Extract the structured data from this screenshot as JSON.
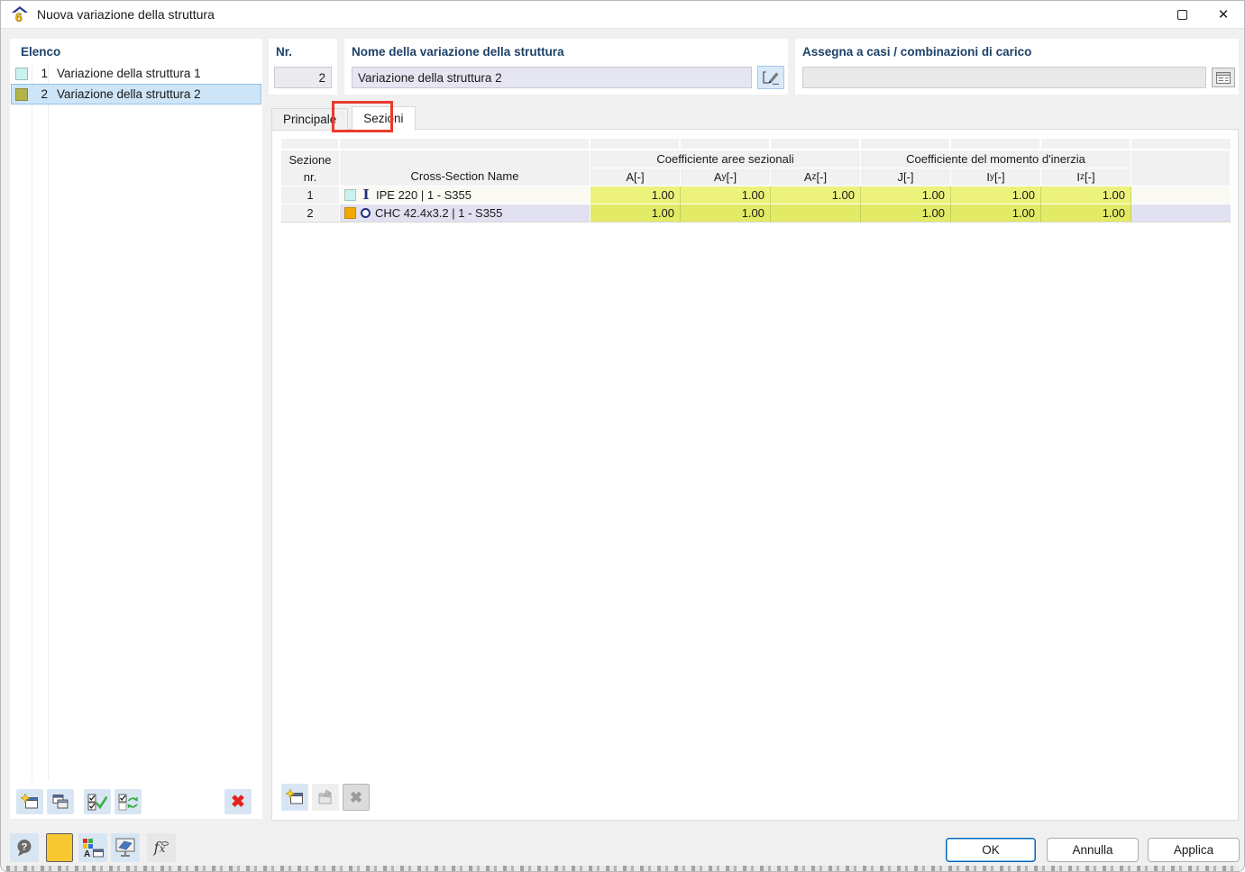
{
  "window": {
    "title": "Nuova variazione della struttura"
  },
  "icons": {
    "close": "✕",
    "delete": "✖",
    "help": "?",
    "app_number": "6",
    "i_section": "I",
    "fx_f": "f",
    "fx_x": "x",
    "display_letter": "A"
  },
  "colors": {
    "accent_navy": "#1D4268",
    "selection_bg": "#CDE5F7",
    "annotation_red": "#E93B2D",
    "ok_border": "#0067C0",
    "value_cell_row1": "#ECF27C",
    "value_cell_row2": "#E2EA66"
  },
  "list_panel": {
    "header": "Elenco",
    "items": [
      {
        "nr": "1",
        "label": "Variazione della struttura 1",
        "color": "#C9F2EF",
        "selected": false
      },
      {
        "nr": "2",
        "label": "Variazione della struttura 2",
        "color": "#B3B347",
        "selected": true
      }
    ]
  },
  "fields": {
    "nr": {
      "label": "Nr.",
      "value": "2"
    },
    "name": {
      "label": "Nome della variazione della struttura",
      "value": "Variazione della struttura 2"
    },
    "assign": {
      "label": "Assegna a casi / combinazioni di carico",
      "value": ""
    }
  },
  "tabs": [
    {
      "label": "Principale",
      "active": false
    },
    {
      "label": "Sezioni",
      "active": true
    }
  ],
  "table": {
    "header": {
      "section_line1": "Sezione",
      "section_line2": "nr.",
      "name": "Cross-Section Name",
      "group_area": "Coefficiente aree sezionali",
      "group_inertia": "Coefficiente del momento d'inerzia",
      "columns": [
        {
          "base": "A",
          "sub": "",
          "unit": " [-]"
        },
        {
          "base": "A",
          "sub": "y",
          "unit": " [-]"
        },
        {
          "base": "A",
          "sub": "z",
          "unit": " [-]"
        },
        {
          "base": "J",
          "sub": "",
          "unit": " [-]"
        },
        {
          "base": "I",
          "sub": "y",
          "unit": " [-]"
        },
        {
          "base": "I",
          "sub": "z",
          "unit": " [-]"
        }
      ]
    },
    "rows": [
      {
        "nr": "1",
        "icon": "i-section-icon",
        "color": "#C9F2EF",
        "name": "IPE 220 | 1 - S355",
        "values": [
          "1.00",
          "1.00",
          "1.00",
          "1.00",
          "1.00",
          "1.00"
        ]
      },
      {
        "nr": "2",
        "icon": "round-section-icon",
        "color": "#F2A900",
        "name": "CHC 42.4x3.2 | 1 - S355",
        "values": [
          "1.00",
          "1.00",
          "",
          "1.00",
          "1.00",
          "1.00"
        ]
      }
    ]
  },
  "footer": {
    "buttons": {
      "ok": "OK",
      "cancel": "Annulla",
      "apply": "Applica"
    }
  }
}
